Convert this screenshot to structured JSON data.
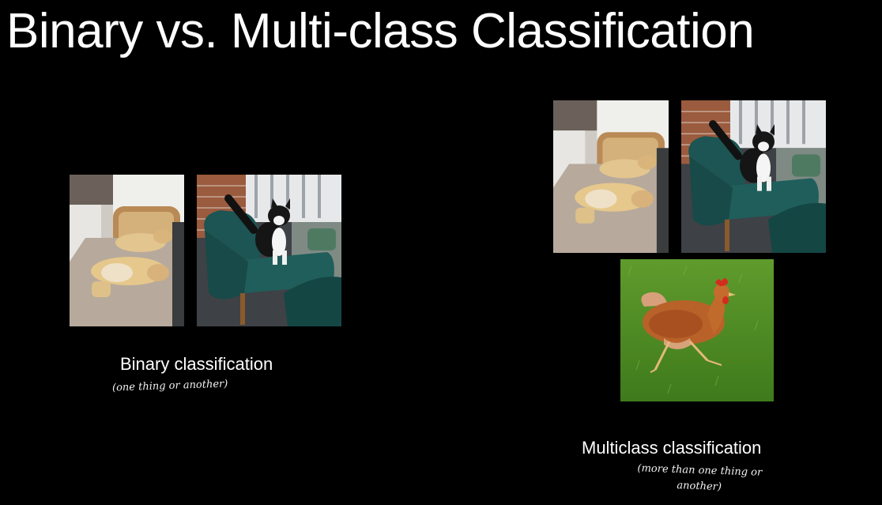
{
  "slide": {
    "title": "Binary vs. Multi-class Classification"
  },
  "binary": {
    "label": "Binary classification",
    "note": "(one thing or another)"
  },
  "multiclass": {
    "label": "Multiclass classification",
    "note": "(more than one thing or another)"
  },
  "images": {
    "dog": "dogs-on-bed",
    "cat": "cat-on-chair",
    "chicken": "chicken-on-grass"
  }
}
